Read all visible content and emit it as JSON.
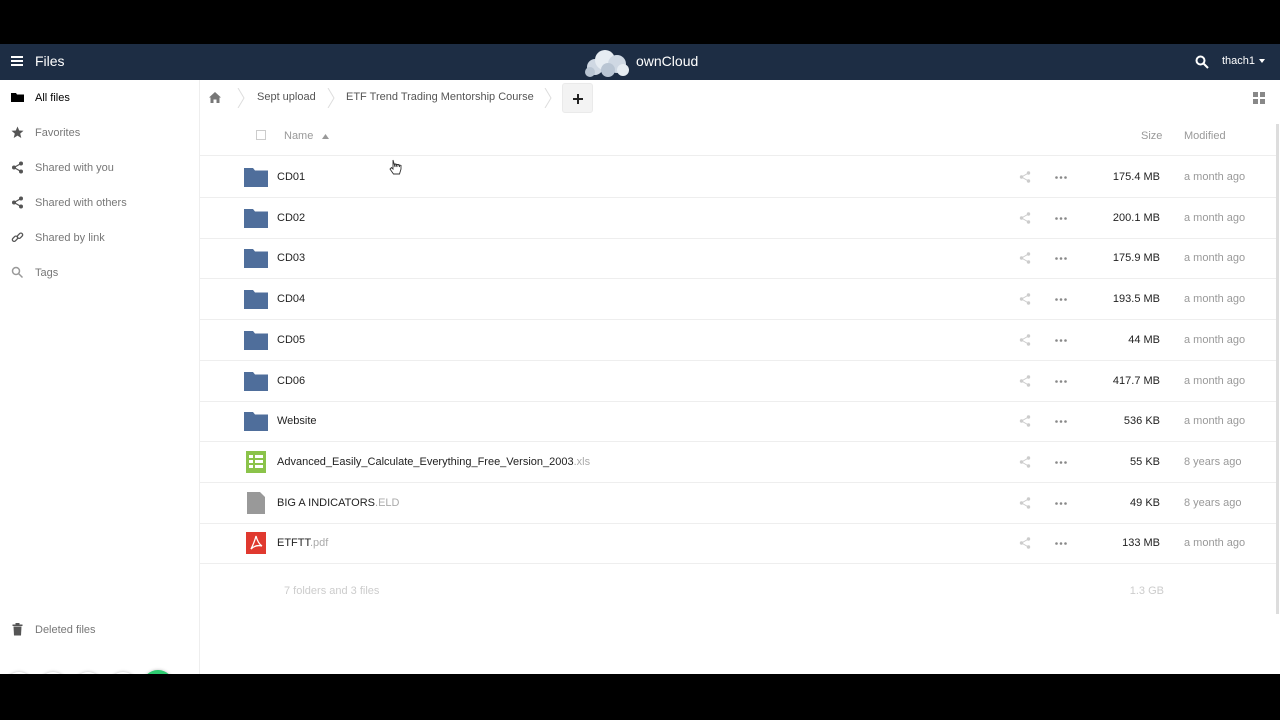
{
  "app": {
    "title": "Files",
    "brand": "ownCloud",
    "user": "thach1"
  },
  "sidebar": {
    "items": [
      {
        "label": "All files",
        "icon": "folder-icon",
        "active": true
      },
      {
        "label": "Favorites",
        "icon": "star-icon",
        "active": false
      },
      {
        "label": "Shared with you",
        "icon": "share-icon",
        "active": false
      },
      {
        "label": "Shared with others",
        "icon": "share-icon",
        "active": false
      },
      {
        "label": "Shared by link",
        "icon": "link-icon",
        "active": false
      },
      {
        "label": "Tags",
        "icon": "tag-search-icon",
        "active": false
      }
    ],
    "bottom": [
      {
        "label": "Deleted files",
        "icon": "trash-icon"
      }
    ]
  },
  "breadcrumb": [
    "Sept upload",
    "ETF Trend Trading Mentorship Course"
  ],
  "table": {
    "col_name": "Name",
    "col_size": "Size",
    "col_modified": "Modified",
    "rows": [
      {
        "name": "CD01",
        "ext": "",
        "type": "folder",
        "size": "175.4 MB",
        "modified": "a month ago"
      },
      {
        "name": "CD02",
        "ext": "",
        "type": "folder",
        "size": "200.1 MB",
        "modified": "a month ago"
      },
      {
        "name": "CD03",
        "ext": "",
        "type": "folder",
        "size": "175.9 MB",
        "modified": "a month ago"
      },
      {
        "name": "CD04",
        "ext": "",
        "type": "folder",
        "size": "193.5 MB",
        "modified": "a month ago"
      },
      {
        "name": "CD05",
        "ext": "",
        "type": "folder",
        "size": "44 MB",
        "modified": "a month ago"
      },
      {
        "name": "CD06",
        "ext": "",
        "type": "folder",
        "size": "417.7 MB",
        "modified": "a month ago"
      },
      {
        "name": "Website",
        "ext": "",
        "type": "folder",
        "size": "536 KB",
        "modified": "a month ago"
      },
      {
        "name": "Advanced_Easily_Calculate_Everything_Free_Version_2003",
        "ext": ".xls",
        "type": "spreadsheet",
        "size": "55 KB",
        "modified": "8 years ago"
      },
      {
        "name": "BIG A INDICATORS",
        "ext": ".ELD",
        "type": "file",
        "size": "49 KB",
        "modified": "8 years ago"
      },
      {
        "name": "ETFTT",
        "ext": ".pdf",
        "type": "pdf",
        "size": "133 MB",
        "modified": "a month ago"
      }
    ],
    "summary": "7 folders and 3 files",
    "total_size": "1.3 GB"
  },
  "colors": {
    "topbar": "#1d2d44",
    "folder": "#4f6e9b",
    "spreadsheet": "#8bc34a",
    "pdf": "#e0392f",
    "file": "#999999",
    "confirm": "#2ecc71"
  }
}
